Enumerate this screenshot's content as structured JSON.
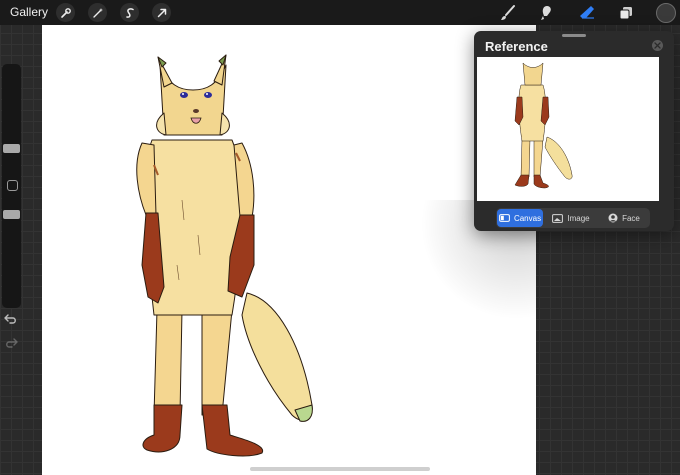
{
  "topbar": {
    "gallery_label": "Gallery",
    "left_tools": [
      "wrench-icon",
      "magic-wand-icon",
      "selection-s-icon",
      "transform-arrow-icon"
    ],
    "right_tools": [
      "brush-icon",
      "smudge-icon",
      "eraser-icon",
      "layers-icon"
    ],
    "active_tool": "eraser-icon",
    "accent_color": "#2f7ef6",
    "current_color": "#3a3a3a"
  },
  "sidebar": {
    "icons": [
      "brush-size-slider",
      "modify-square-icon",
      "opacity-slider",
      "undo-icon",
      "redo-icon"
    ]
  },
  "reference": {
    "title": "Reference",
    "close_icon": "close-icon",
    "tabs": [
      {
        "label": "Canvas",
        "icon": "canvas-icon",
        "active": true
      },
      {
        "label": "Image",
        "icon": "image-icon",
        "active": false
      },
      {
        "label": "Face",
        "icon": "face-icon",
        "active": false
      }
    ]
  }
}
